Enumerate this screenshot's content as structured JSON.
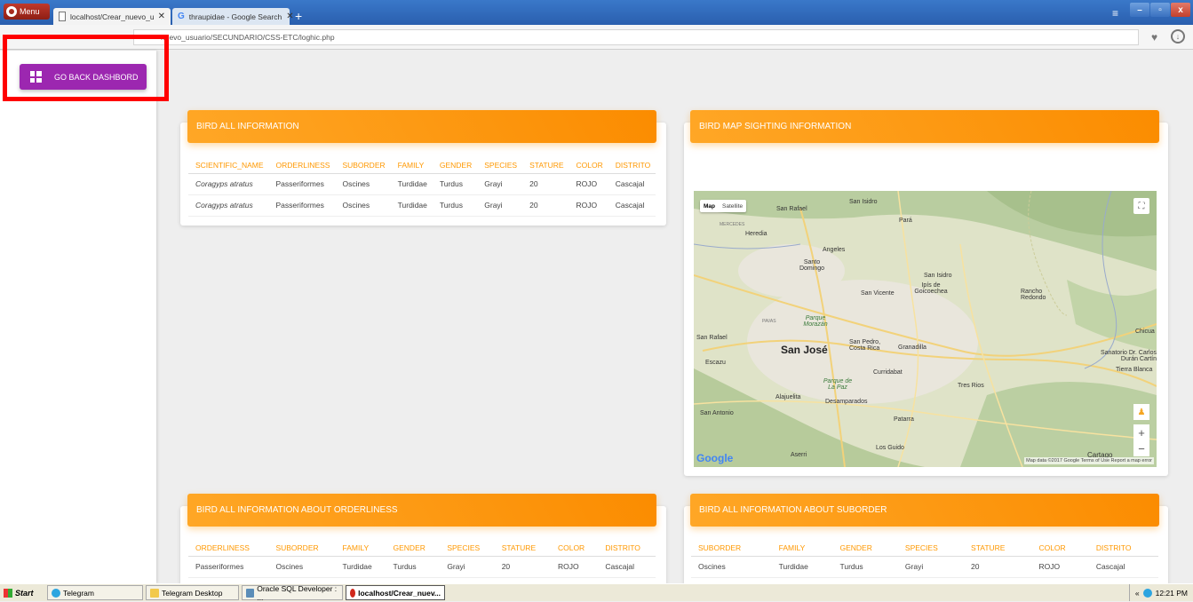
{
  "browser": {
    "menu_label": "Menu",
    "tabs": [
      {
        "title": "localhost/Crear_nuevo_usua",
        "close": "✕"
      },
      {
        "title": "thraupidae - Google Search",
        "close": "✕"
      }
    ],
    "new_tab": "+",
    "url": "nuevo_usuario/SECUNDARIO/CSS-ETC/loghic.php"
  },
  "sidebar": {
    "back_button_label": "GO BACK DASHBORD"
  },
  "cards": {
    "all_info": {
      "title": "BIRD ALL INFORMATION",
      "columns": [
        "SCIENTIFIC_NAME",
        "ORDERLINESS",
        "SUBORDER",
        "FAMILY",
        "GENDER",
        "SPECIES",
        "STATURE",
        "COLOR",
        "DISTRITO"
      ],
      "rows": [
        [
          "Coragyps atratus",
          "Passeriformes",
          "Oscines",
          "Turdidae",
          "Turdus",
          "Grayi",
          "20",
          "ROJO",
          "Cascajal"
        ],
        [
          "Coragyps atratus",
          "Passeriformes",
          "Oscines",
          "Turdidae",
          "Turdus",
          "Grayi",
          "20",
          "ROJO",
          "Cascajal"
        ]
      ]
    },
    "map_info": {
      "title": "BIRD MAP SIGHTING INFORMATION",
      "map_type": [
        "Map",
        "Satellite"
      ],
      "city": "San José",
      "labels": [
        "San Rafael",
        "San Isidro",
        "Pará",
        "Heredia",
        "Angeles",
        "Santo Domingo",
        "San Isidro",
        "Ipís de Goicoechea",
        "San Vicente",
        "Rancho Redondo",
        "Parque Morazán",
        "San Pedro, Costa Rica",
        "Granadilla",
        "Sanatorio Dr. Carlos Durán Cartín",
        "Tierra Blanca",
        "Chicua",
        "Escazu",
        "Curridabat",
        "Parque de La Paz",
        "Tres Rios",
        "Alajuelita",
        "Desamparados",
        "San Antonio",
        "Patarra",
        "Los Guido",
        "Aserri",
        "Cartago",
        "San Rafael",
        "PAVAS",
        "MERCEDES"
      ],
      "google": "Google",
      "attribution": "Map data ©2017 Google   Terms of Use   Report a map error"
    },
    "orderliness": {
      "title": "BIRD ALL INFORMATION ABOUT ORDERLINESS",
      "columns": [
        "ORDERLINESS",
        "SUBORDER",
        "FAMILY",
        "GENDER",
        "SPECIES",
        "STATURE",
        "COLOR",
        "DISTRITO"
      ],
      "rows": [
        [
          "Passeriformes",
          "Oscines",
          "Turdidae",
          "Turdus",
          "Grayi",
          "20",
          "ROJO",
          "Cascajal"
        ]
      ]
    },
    "suborder": {
      "title": "BIRD ALL INFORMATION ABOUT SUBORDER",
      "columns": [
        "SUBORDER",
        "FAMILY",
        "GENDER",
        "SPECIES",
        "STATURE",
        "COLOR",
        "DISTRITO"
      ],
      "rows": [
        [
          "Oscines",
          "Turdidae",
          "Turdus",
          "Grayi",
          "20",
          "ROJO",
          "Cascajal"
        ]
      ]
    }
  },
  "taskbar": {
    "start": "Start",
    "tasks": [
      "Telegram",
      "Telegram Desktop",
      "Oracle SQL Developer : ...",
      "localhost/Crear_nuev..."
    ],
    "clock": "12:21 PM"
  }
}
